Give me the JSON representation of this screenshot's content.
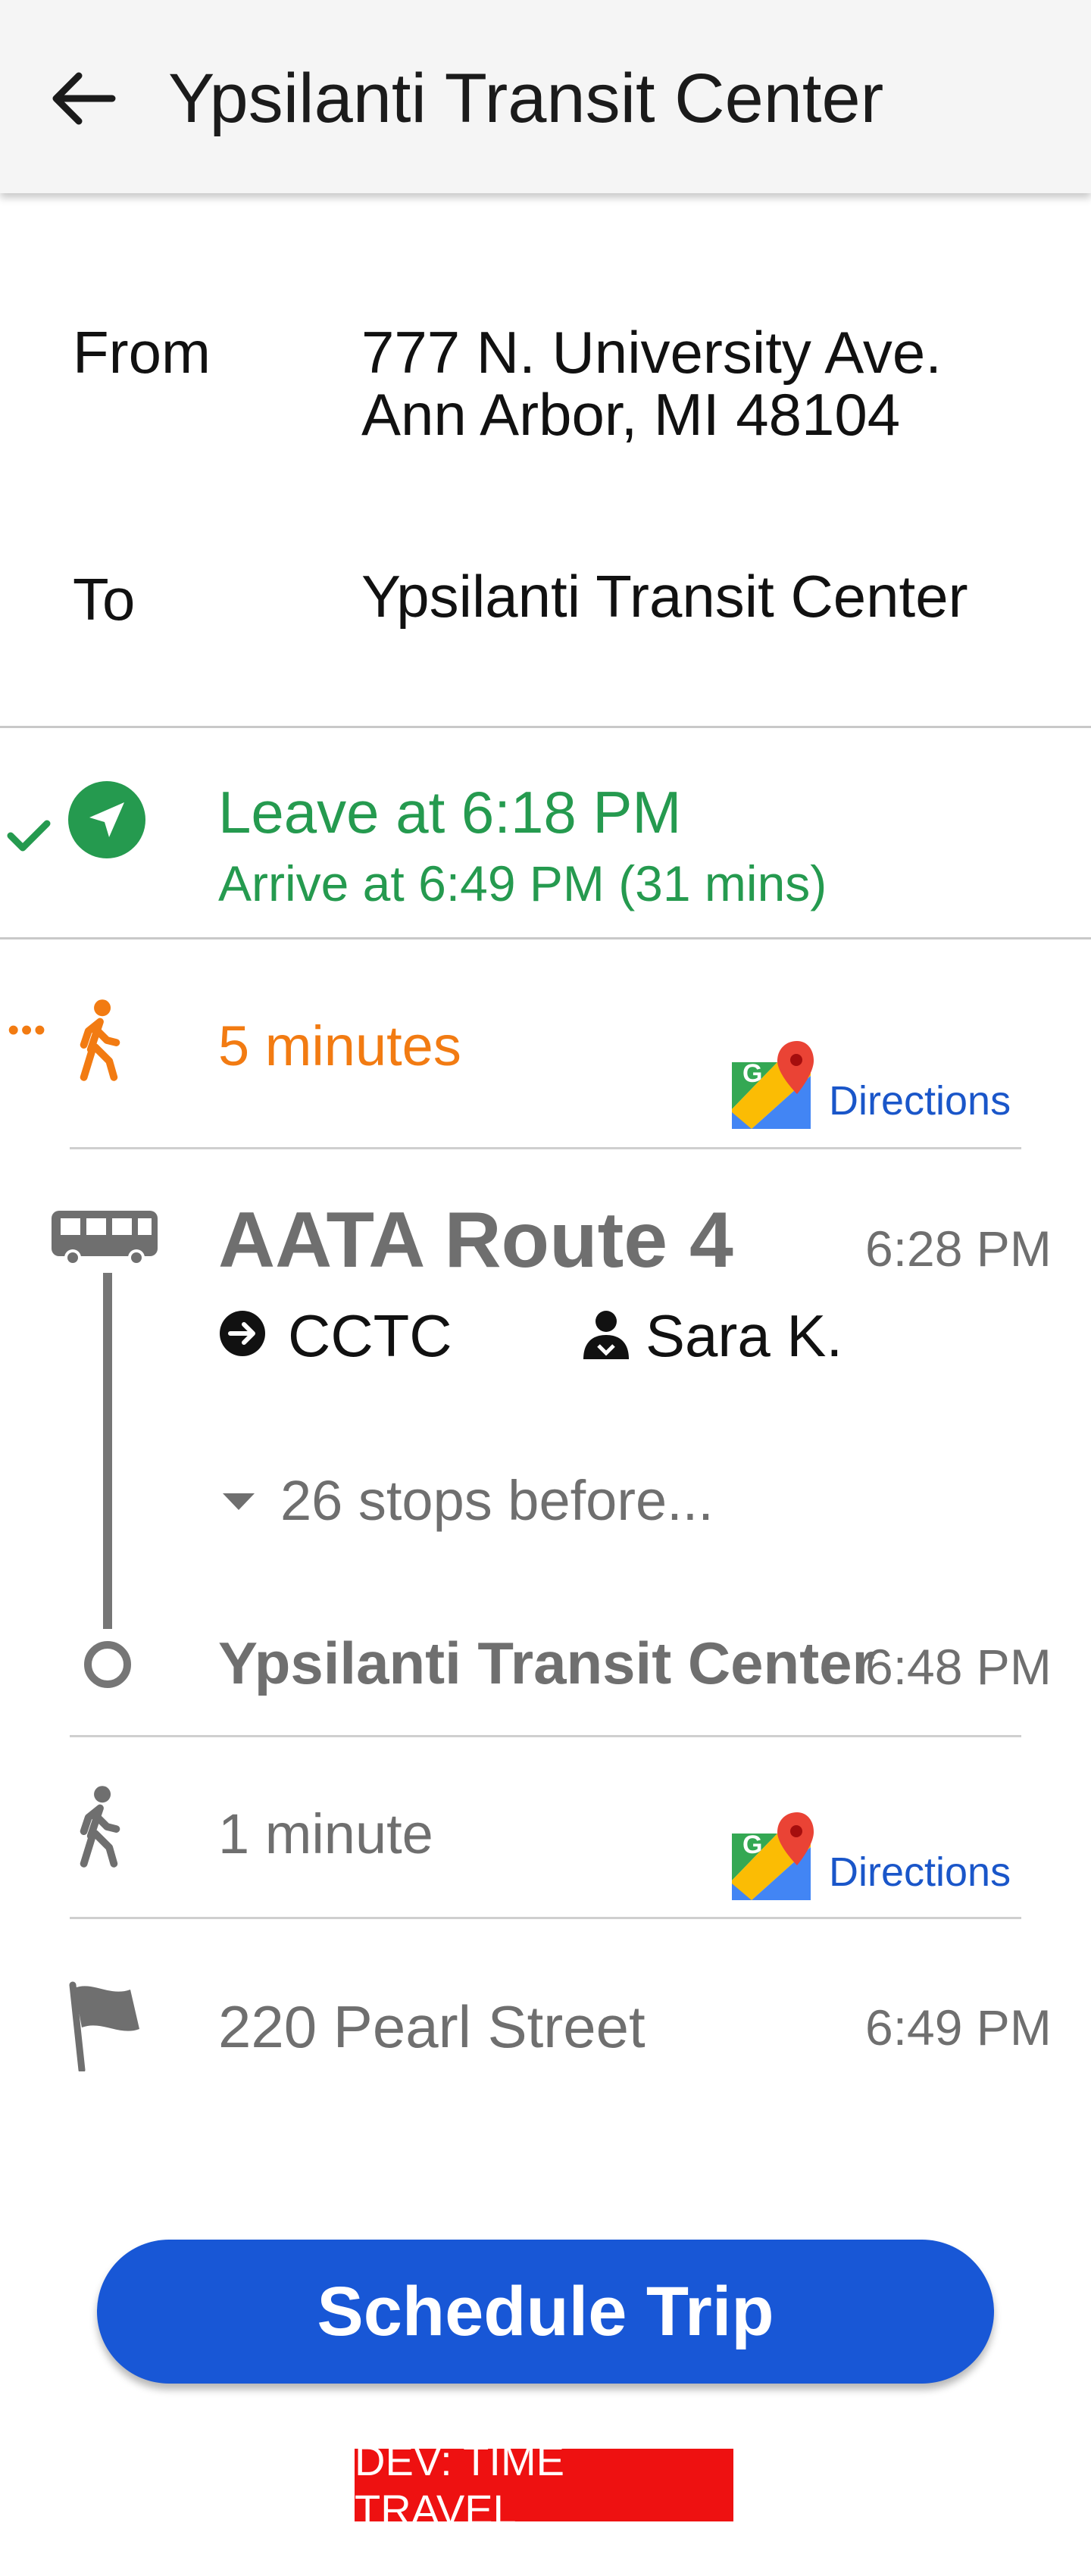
{
  "header": {
    "title": "Ypsilanti Transit Center"
  },
  "trip": {
    "from_label": "From",
    "from_line1": "777 N. University Ave.",
    "from_line2": "Ann Arbor, MI 48104",
    "to_label": "To",
    "to_value": "Ypsilanti Transit Center"
  },
  "summary": {
    "leave": "Leave at 6:18 PM",
    "arrive": "Arrive at 6:49 PM (31 mins)"
  },
  "walk1": {
    "duration": "5 minutes",
    "directions_label": "Directions"
  },
  "bus": {
    "route": "AATA Route 4",
    "depart_time": "6:28 PM",
    "destination": "CCTC",
    "driver": "Sara K.",
    "stops_toggle": "26 stops before...",
    "alight_stop": "Ypsilanti Transit Center",
    "alight_time": "6:48 PM"
  },
  "walk2": {
    "duration": "1 minute",
    "directions_label": "Directions"
  },
  "final": {
    "place": "220 Pearl Street",
    "time": "6:49 PM"
  },
  "actions": {
    "schedule_label": "Schedule Trip"
  },
  "dev_badge": "DEV: TIME TRAVEL",
  "colors": {
    "accent_green": "#259a4f",
    "accent_orange": "#f27b12",
    "button_blue": "#1857d6",
    "link_blue": "#1a56c9",
    "dev_red": "#ee1111"
  },
  "icons": {
    "back": "arrow-left-icon",
    "navigate": "navigation-arrow-icon",
    "selected": "checkmark-icon",
    "walk": "walking-person-icon",
    "maps": "google-maps-icon",
    "bus": "bus-icon",
    "destination": "arrow-circle-icon",
    "driver": "person-icon",
    "expand": "caret-down-icon",
    "flag": "flag-icon"
  }
}
